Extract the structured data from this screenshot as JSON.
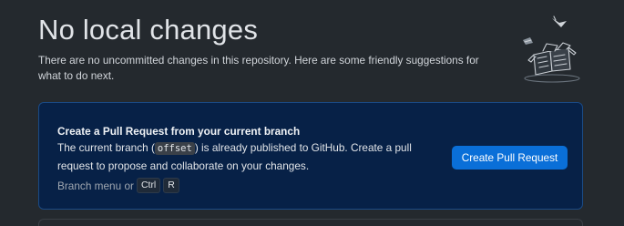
{
  "header": {
    "title": "No local changes",
    "subtitle": "There are no uncommitted changes in this repository. Here are some friendly suggestions for what to do next."
  },
  "illustration": {
    "icon": "empty-repo-illustration-icon"
  },
  "pull_request_card": {
    "title": "Create a Pull Request from your current branch",
    "desc_before": "The current branch (",
    "branch_name": "offset",
    "desc_after": ") is already published to GitHub. Create a pull request to propose and collaborate on your changes.",
    "hint_prefix": "Branch menu or",
    "shortcut_keys": [
      "Ctrl",
      "R"
    ],
    "button_label": "Create Pull Request"
  },
  "colors": {
    "background": "#24292e",
    "card_background": "#072147",
    "card_border": "#1a4a85",
    "accent_button": "#0a6fd8"
  }
}
